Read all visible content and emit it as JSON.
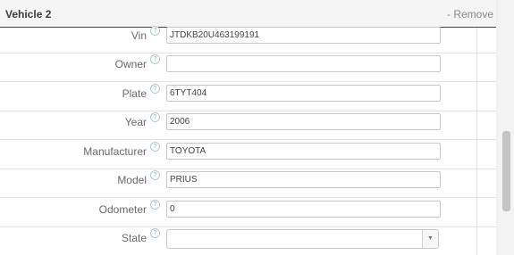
{
  "section": {
    "title": "Vehicle 2",
    "remove_label": "- Remove"
  },
  "help_glyph": "?",
  "fields": {
    "vin": {
      "label": "Vin",
      "value": "JTDKB20U463199191"
    },
    "owner": {
      "label": "Owner",
      "value": ""
    },
    "plate": {
      "label": "Plate",
      "value": "6TYT404"
    },
    "year": {
      "label": "Year",
      "value": "2006"
    },
    "manufacturer": {
      "label": "Manufacturer",
      "value": "TOYOTA"
    },
    "model": {
      "label": "Model",
      "value": "PRIUS"
    },
    "odometer": {
      "label": "Odometer",
      "value": "0"
    },
    "state": {
      "label": "State",
      "value": ""
    }
  },
  "icons": {
    "help": "help-icon",
    "dropdown": "chevron-down-icon"
  },
  "dropdown_glyph": "▼",
  "colors": {
    "header_rule": "#444444",
    "help_icon": "#8fb0c4",
    "remove_link": "#8a8a8a"
  }
}
